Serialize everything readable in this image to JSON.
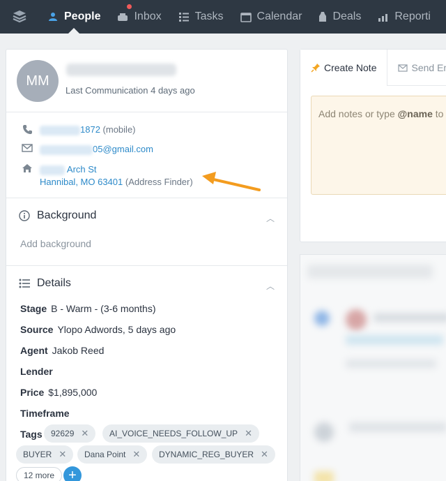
{
  "nav": {
    "items": [
      {
        "label": "People",
        "icon": "people-icon",
        "active": true
      },
      {
        "label": "Inbox",
        "icon": "inbox-icon",
        "active": false
      },
      {
        "label": "Tasks",
        "icon": "tasks-icon",
        "active": false
      },
      {
        "label": "Calendar",
        "icon": "calendar-icon",
        "active": false
      },
      {
        "label": "Deals",
        "icon": "deals-icon",
        "active": false
      },
      {
        "label": "Reporti",
        "icon": "reporting-icon",
        "active": false
      }
    ],
    "bg_color": "#2e3843"
  },
  "profile": {
    "initials": "MM",
    "last_communication": "Last Communication 4 days ago"
  },
  "contact": {
    "phone_suffix": "1872",
    "phone_type": "(mobile)",
    "email_suffix": "05@gmail.com",
    "address_line1": "Arch St",
    "address_line2": "Hannibal, MO 63401",
    "address_finder": "(Address Finder)"
  },
  "background": {
    "title": "Background",
    "placeholder": "Add background"
  },
  "details": {
    "title": "Details",
    "stage_label": "Stage",
    "stage_value": "B - Warm - (3-6 months)",
    "source_label": "Source",
    "source_value": "Ylopo Adwords, 5 days ago",
    "agent_label": "Agent",
    "agent_value": "Jakob Reed",
    "lender_label": "Lender",
    "price_label": "Price",
    "price_value": "$1,895,000",
    "timeframe_label": "Timeframe",
    "tags_label": "Tags",
    "tags": [
      "92629",
      "AI_VOICE_NEEDS_FOLLOW_UP",
      "BUYER",
      "Dana Point",
      "DYNAMIC_REG_BUYER"
    ],
    "more_tags": "12 more",
    "add_symbol": "+"
  },
  "composer": {
    "tab_create_note": "Create Note",
    "tab_send_email": "Send Em",
    "placeholder_prefix": "Add notes or type ",
    "placeholder_bold": "@name",
    "placeholder_suffix": " to n"
  },
  "colors": {
    "accent": "#3397db",
    "link": "#2d8ac9",
    "annotation_arrow": "#f39c1f"
  }
}
